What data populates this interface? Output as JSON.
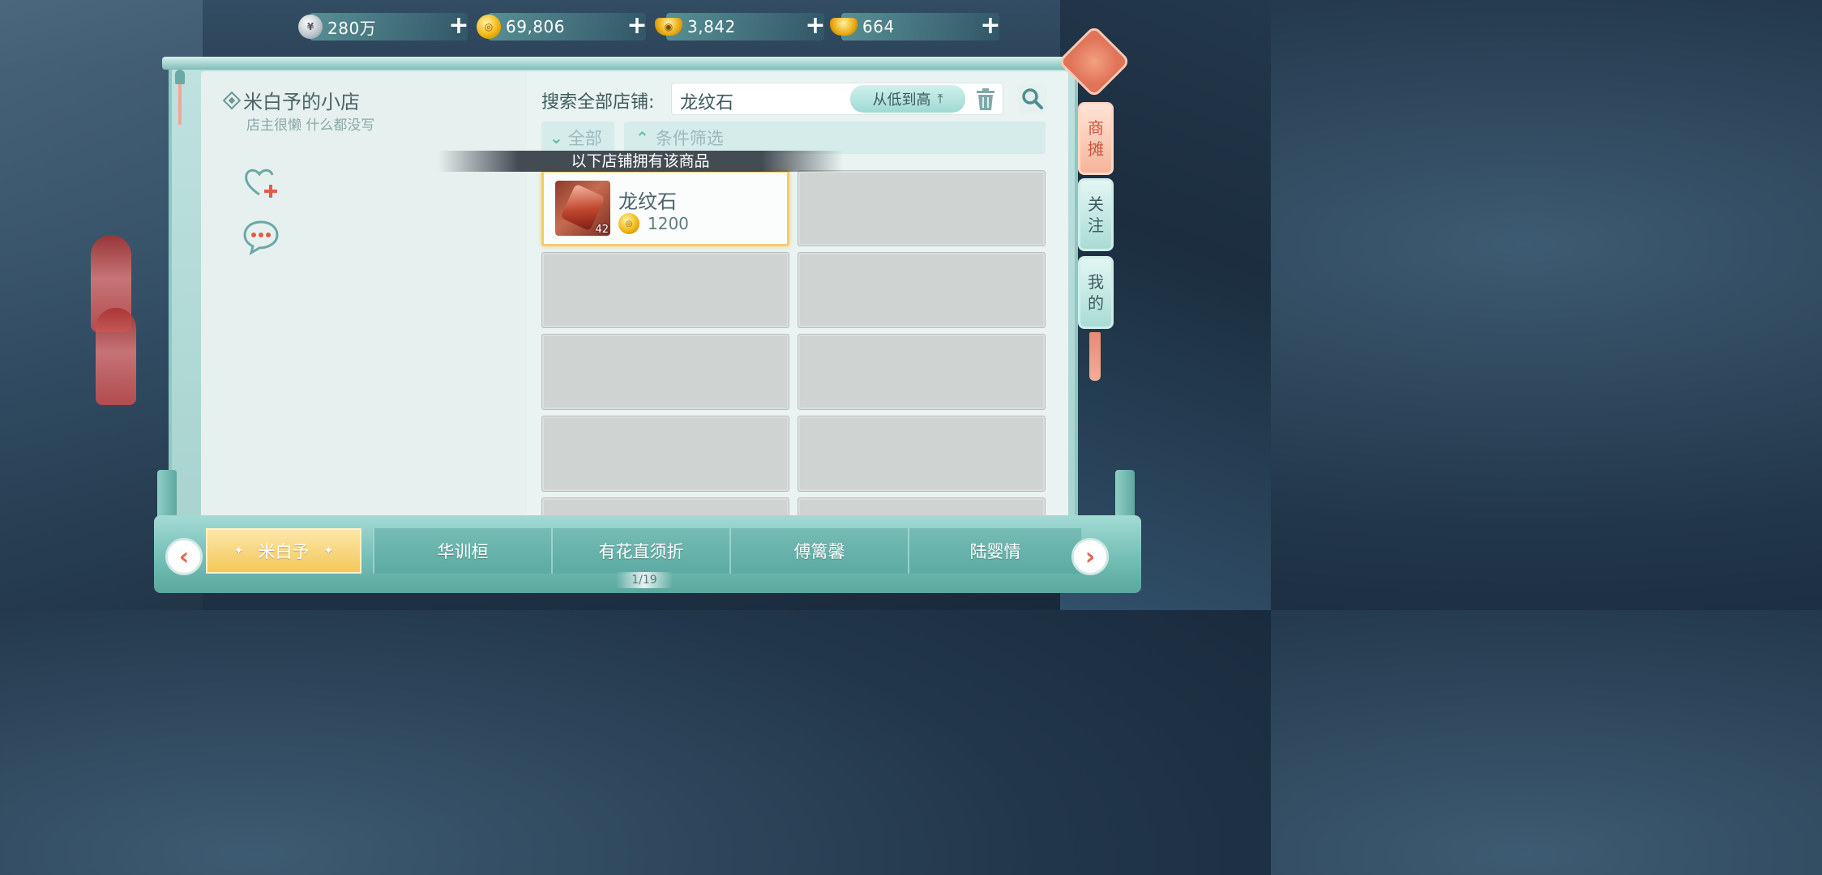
{
  "currencies": [
    {
      "icon": "silver-coin-icon",
      "value": "280万"
    },
    {
      "icon": "copper-coin-icon",
      "value": "69,806"
    },
    {
      "icon": "gold-coin-icon",
      "value": "3,842"
    },
    {
      "icon": "gold-ingot-icon",
      "value": "664"
    }
  ],
  "shop": {
    "name": "米白予的小店",
    "description": "店主很懒 什么都没写"
  },
  "search": {
    "label": "搜索全部店铺:",
    "query": "龙纹石",
    "sort_label": "从低到高",
    "sort_arrow": "⤒"
  },
  "filters": {
    "all_label": "全部",
    "condition_label": "条件筛选"
  },
  "banner_text": "以下店铺拥有该商品",
  "items": [
    {
      "name": "龙纹石",
      "price": "1200",
      "count": "42"
    }
  ],
  "side_tabs": [
    {
      "label_1": "商",
      "label_2": "摊"
    },
    {
      "label_1": "关",
      "label_2": "注"
    },
    {
      "label_1": "我",
      "label_2": "的"
    }
  ],
  "shop_tabs": [
    "米白予",
    "华训桓",
    "有花直须折",
    "傅篱馨",
    "陆婴情"
  ],
  "page_indicator": "1/19"
}
